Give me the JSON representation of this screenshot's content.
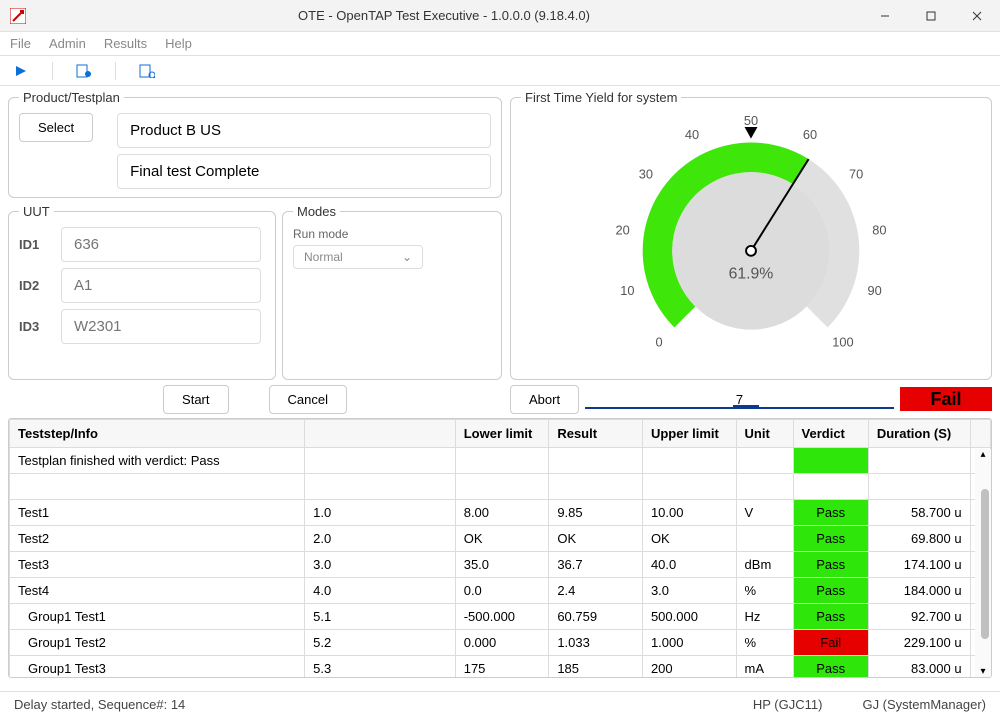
{
  "window": {
    "title": "OTE - OpenTAP Test Executive - 1.0.0.0 (9.18.4.0)"
  },
  "menu": {
    "file": "File",
    "admin": "Admin",
    "results": "Results",
    "help": "Help"
  },
  "product": {
    "legend": "Product/Testplan",
    "select_label": "Select",
    "field1": "Product B US",
    "field2": "Final test Complete"
  },
  "uut": {
    "legend": "UUT",
    "id1_label": "ID1",
    "id1_value": "636",
    "id2_label": "ID2",
    "id2_value": "A1",
    "id3_label": "ID3",
    "id3_value": "W2301"
  },
  "modes": {
    "legend": "Modes",
    "runmode_label": "Run mode",
    "runmode_value": "Normal"
  },
  "yield": {
    "legend": "First Time Yield for system",
    "value": 61.9,
    "value_text": "61.9%",
    "ticks": [
      "0",
      "10",
      "20",
      "30",
      "40",
      "50",
      "60",
      "70",
      "80",
      "90",
      "100"
    ]
  },
  "controls": {
    "start": "Start",
    "cancel": "Cancel",
    "abort": "Abort",
    "progress_text": "7",
    "overall_verdict": "Fail"
  },
  "grid": {
    "headers": {
      "teststep": "Teststep/Info",
      "seq": "",
      "lower": "Lower limit",
      "result": "Result",
      "upper": "Upper limit",
      "unit": "Unit",
      "verdict": "Verdict",
      "duration": "Duration (S)"
    },
    "inforow": "Testplan finished with verdict: Pass",
    "rows": [
      {
        "name": "Test1",
        "seq": "1.0",
        "lower": "8.00",
        "res": "9.85",
        "upper": "10.00",
        "unit": "V",
        "verdict": "Pass",
        "dur": "58.700 u"
      },
      {
        "name": "Test2",
        "seq": "2.0",
        "lower": "OK",
        "res": "OK",
        "upper": "OK",
        "unit": "",
        "verdict": "Pass",
        "dur": "69.800 u"
      },
      {
        "name": "Test3",
        "seq": "3.0",
        "lower": "35.0",
        "res": "36.7",
        "upper": "40.0",
        "unit": "dBm",
        "verdict": "Pass",
        "dur": "174.100 u"
      },
      {
        "name": "Test4",
        "seq": "4.0",
        "lower": "0.0",
        "res": "2.4",
        "upper": "3.0",
        "unit": "%",
        "verdict": "Pass",
        "dur": "184.000 u"
      },
      {
        "name": "  Group1 Test1",
        "seq": "5.1",
        "lower": "-500.000",
        "res": "60.759",
        "upper": "500.000",
        "unit": "Hz",
        "verdict": "Pass",
        "dur": "92.700 u"
      },
      {
        "name": "  Group1 Test2",
        "seq": "5.2",
        "lower": "0.000",
        "res": "1.033",
        "upper": "1.000",
        "unit": "%",
        "verdict": "Fail",
        "dur": "229.100 u"
      },
      {
        "name": "  Group1 Test3",
        "seq": "5.3",
        "lower": "175",
        "res": "185",
        "upper": "200",
        "unit": "mA",
        "verdict": "Pass",
        "dur": "83.000 u"
      }
    ]
  },
  "status": {
    "left": "Delay started, Sequence#: 14",
    "device": "HP (GJC11)",
    "user": "GJ (SystemManager)"
  },
  "chart_data": {
    "type": "gauge",
    "title": "First Time Yield for system",
    "value": 61.9,
    "min": 0,
    "max": 100,
    "green_fill_end": 61.9,
    "marker": 50,
    "ticks": [
      0,
      10,
      20,
      30,
      40,
      50,
      60,
      70,
      80,
      90,
      100
    ]
  }
}
